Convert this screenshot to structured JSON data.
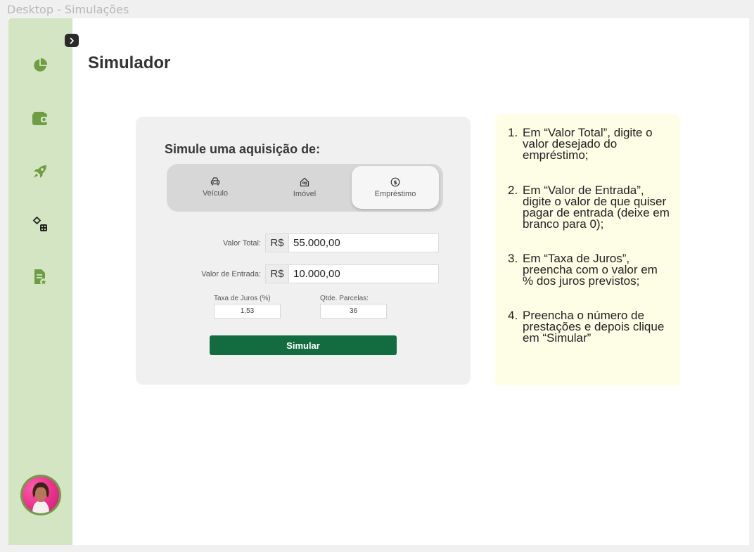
{
  "frame_label": "Desktop - Simulações",
  "page": {
    "title": "Simulador"
  },
  "sidebar": {
    "collapse_icon": "chevron-right-icon",
    "items": [
      {
        "icon": "pie-chart-icon"
      },
      {
        "icon": "wallet-icon"
      },
      {
        "icon": "rocket-icon"
      },
      {
        "icon": "game-pieces-icon"
      },
      {
        "icon": "document-star-icon"
      }
    ],
    "accent": "#6e9d43",
    "background": "#d3e5c2"
  },
  "simulator": {
    "heading": "Simule uma aquisição de:",
    "tabs": [
      {
        "label": "Veículo",
        "icon": "car-icon",
        "active": false
      },
      {
        "label": "Imóvel",
        "icon": "house-icon",
        "active": false
      },
      {
        "label": "Empréstimo",
        "icon": "dollar-coin-icon",
        "active": true
      }
    ],
    "valor_total": {
      "label": "Valor Total:",
      "prefix": "R$",
      "value": "55.000,00"
    },
    "valor_entrada": {
      "label": "Valor de Entrada:",
      "prefix": "R$",
      "value": "10.000,00"
    },
    "taxa_juros": {
      "label": "Taxa de Juros (%)",
      "value": "1,53"
    },
    "parcelas": {
      "label": "Qtde. Parcelas:",
      "value": "36"
    },
    "submit_label": "Simular",
    "button_color": "#136b40"
  },
  "help": {
    "background": "#fefde6",
    "steps": [
      {
        "num": "1.",
        "text": "Em “Valor Total”, digite o valor desejado do empréstimo;"
      },
      {
        "num": "2.",
        "text": "Em “Valor de Entrada”, digite o valor de que quiser pagar de entrada (deixe em branco para 0);"
      },
      {
        "num": "3.",
        "text": "Em “Taxa de Juros”, preencha com o valor em % dos juros previstos;"
      },
      {
        "num": "4.",
        "text": "Preencha o número de prestações e depois clique em “Simular”"
      }
    ]
  }
}
